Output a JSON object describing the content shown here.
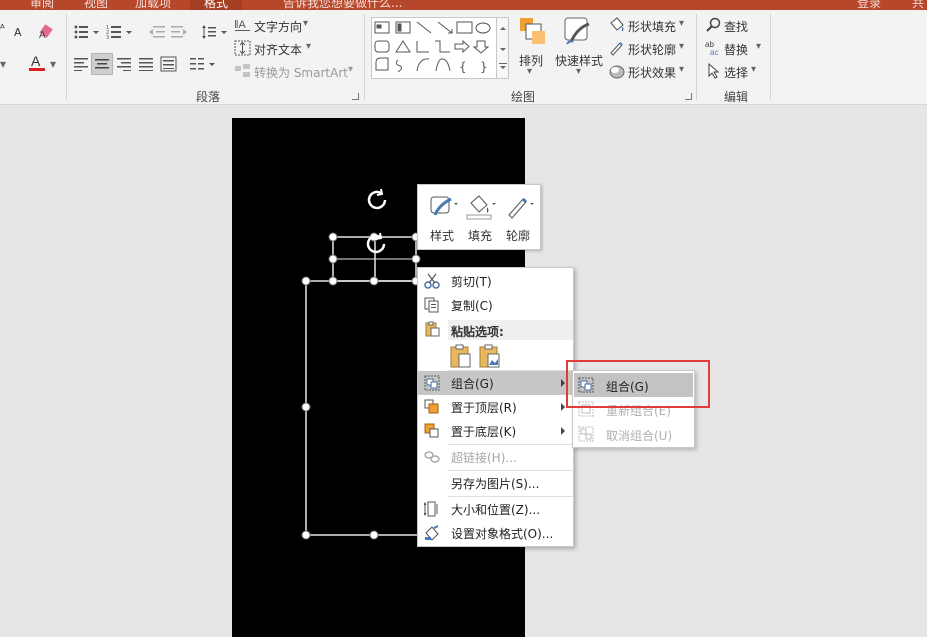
{
  "titlebar": {
    "tabs": [
      "审阅",
      "视图",
      "加载项",
      "格式"
    ],
    "active_tab": "格式",
    "search_text": "告诉我您想要做什么...",
    "login": "登录",
    "share": "共"
  },
  "ribbon": {
    "paragraph": {
      "label": "段落",
      "text_direction": "文字方向",
      "align_text": "对齐文本",
      "convert_smartart": "转换为 SmartArt"
    },
    "drawing": {
      "label": "绘图",
      "arrange": "排列",
      "quick_styles": "快速样式",
      "shape_fill": "形状填充",
      "shape_outline": "形状轮廓",
      "shape_effects": "形状效果"
    },
    "editing": {
      "label": "编辑",
      "find": "查找",
      "replace": "替换",
      "select": "选择"
    }
  },
  "minibar": {
    "style": "样式",
    "fill": "填充",
    "outline": "轮廓"
  },
  "context_menu": {
    "cut": "剪切(T)",
    "copy": "复制(C)",
    "paste_options": "粘贴选项:",
    "group": "组合(G)",
    "bring_to_front": "置于顶层(R)",
    "send_to_back": "置于底层(K)",
    "hyperlink": "超链接(H)...",
    "save_as_picture": "另存为图片(S)...",
    "size_position": "大小和位置(Z)...",
    "format_object": "设置对象格式(O)..."
  },
  "submenu": {
    "group": "组合(G)",
    "regroup": "重新组合(E)",
    "ungroup": "取消组合(U)"
  },
  "colors": {
    "accent": "#b7472a",
    "highlight_box": "#e33a3a",
    "slide": "#000000",
    "menu_highlight": "#c6c6c6"
  }
}
